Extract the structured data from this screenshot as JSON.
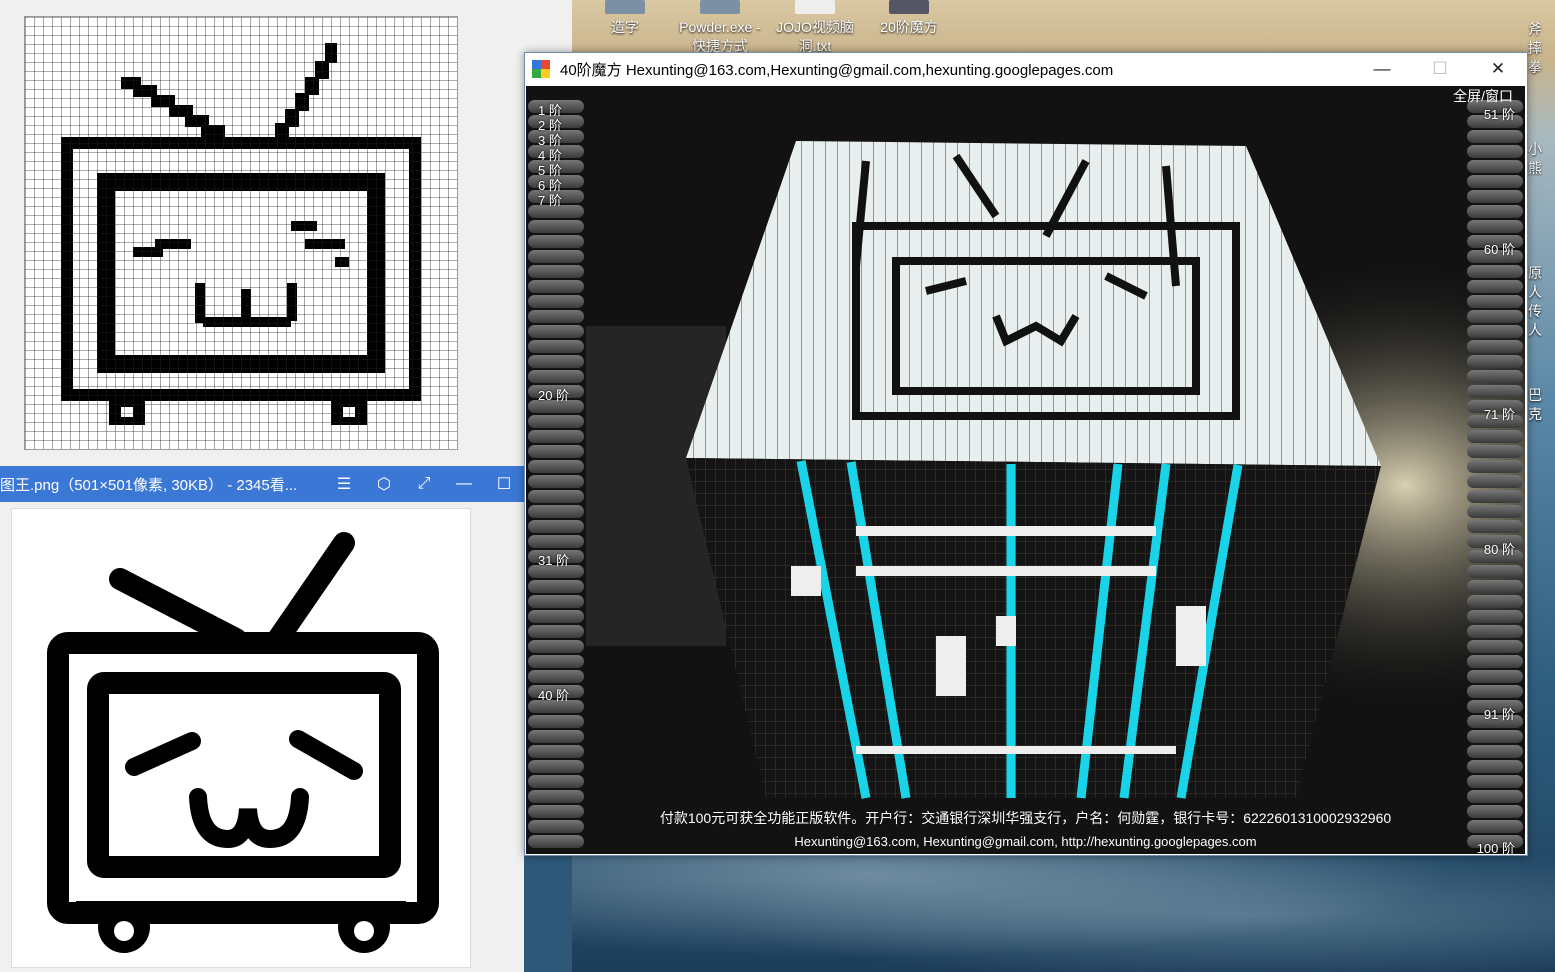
{
  "desktop": {
    "icons": [
      {
        "label": "造字"
      },
      {
        "label": "Powder.exe - 快捷方式"
      },
      {
        "label": "JOJO视频脑洞.txt"
      },
      {
        "label": "20阶魔方"
      }
    ],
    "side_labels": [
      "斧摔拳",
      "小熊",
      "原人传人",
      "巴克"
    ]
  },
  "viewer": {
    "title": "图王.png（501×501像素, 30KB） - 2345看...",
    "buttons": {
      "menu": "☰",
      "skin": "⬡",
      "fullscreen": "⤢",
      "minimize": "—",
      "maximize": "☐"
    }
  },
  "cube_window": {
    "title": "40阶魔方 Hexunting@163.com,Hexunting@gmail.com,hexunting.googlepages.com",
    "buttons": {
      "minimize": "—",
      "maximize": "☐",
      "close": "✕"
    },
    "fullscreen_toggle": "全屏/窗口",
    "left_levels": [
      "1 阶",
      "2 阶",
      "3 阶",
      "4 阶",
      "5 阶",
      "6 阶",
      "7 阶",
      "20 阶",
      "31 阶",
      "40 阶"
    ],
    "right_levels": [
      "51 阶",
      "60 阶",
      "71 阶",
      "80 阶",
      "91 阶",
      "100 阶"
    ],
    "notice": "付款100元可获全功能正版软件。开户行：交通银行深圳华强支行，户名：何勋霆，银行卡号：6222601310002932960",
    "contact": "Hexunting@163.com,  Hexunting@gmail.com,  http://hexunting.googlepages.com"
  },
  "colors": {
    "accent_blue": "#3b78d6",
    "cube_cyan": "#19d4e8",
    "cube_white": "#e8eeee"
  }
}
